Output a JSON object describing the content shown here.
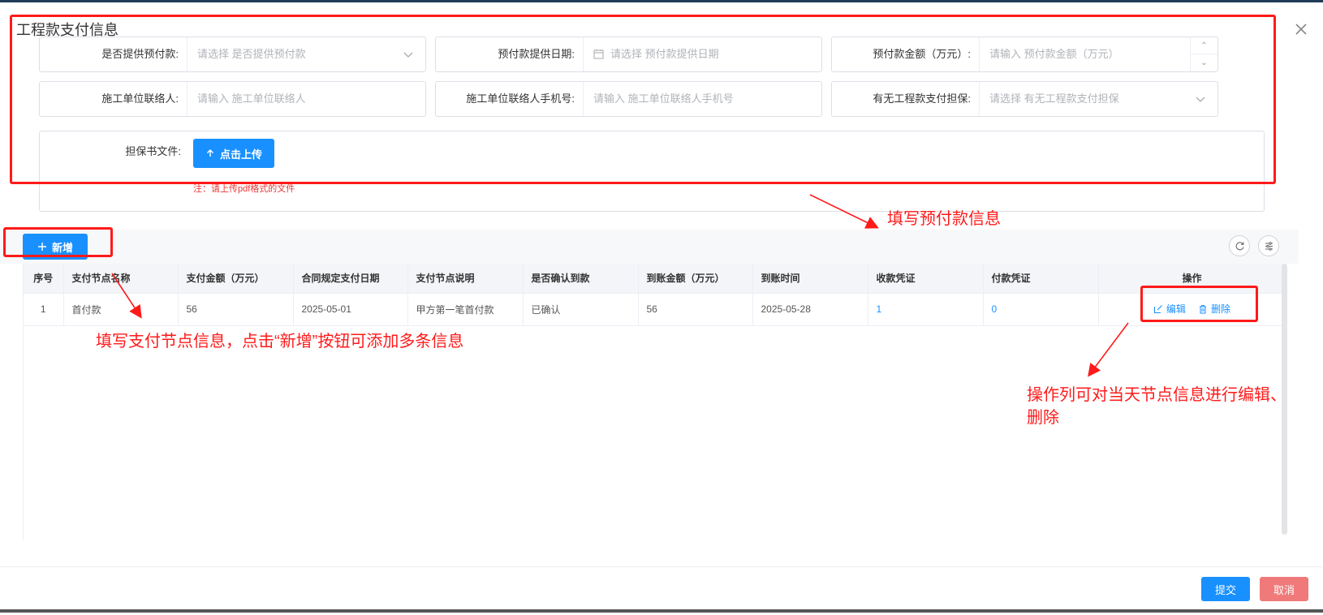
{
  "dialog": {
    "title": "工程款支付信息"
  },
  "form": {
    "row1": [
      {
        "label": "是否提供预付款:",
        "placeholder": "请选择 是否提供预付款",
        "kind": "select"
      },
      {
        "label": "预付款提供日期:",
        "placeholder": "请选择 预付款提供日期",
        "kind": "date"
      },
      {
        "label": "预付款金额（万元）:",
        "placeholder": "请输入 预付款金额（万元）",
        "kind": "number"
      }
    ],
    "row2": [
      {
        "label": "施工单位联络人:",
        "placeholder": "请输入 施工单位联络人",
        "kind": "text"
      },
      {
        "label": "施工单位联络人手机号:",
        "placeholder": "请输入 施工单位联络人手机号",
        "kind": "text"
      },
      {
        "label": "有无工程款支付担保:",
        "placeholder": "请选择 有无工程款支付担保",
        "kind": "select"
      }
    ],
    "upload": {
      "label": "担保书文件:",
      "button": "点击上传",
      "note": "注：请上传pdf格式的文件"
    }
  },
  "toolbar": {
    "add_label": "新增"
  },
  "table": {
    "headers": [
      "序号",
      "支付节点名称",
      "支付金额（万元）",
      "合同规定支付日期",
      "支付节点说明",
      "是否确认到款",
      "到账金额（万元）",
      "到账时间",
      "收款凭证",
      "付款凭证",
      "操作"
    ],
    "rows": [
      [
        "1",
        "首付款",
        "56",
        "2025-05-01",
        "甲方第一笔首付款",
        "已确认",
        "56",
        "2025-05-28",
        "1",
        "0"
      ]
    ],
    "actions": {
      "edit": "编辑",
      "delete": "删除"
    }
  },
  "footer": {
    "submit": "提交",
    "cancel": "取消"
  },
  "annotations": {
    "prepay": "填写预付款信息",
    "nodes": "填写支付节点信息，点击“新增”按钮可添加多条信息",
    "ops_line1": "操作列可对当天节点信息进行编辑、",
    "ops_line2": "删除",
    "color": "#ff1a1a"
  },
  "colors": {
    "primary": "#1890ff",
    "cancel": "#f07a7a",
    "annotation": "#ff1a1a"
  }
}
